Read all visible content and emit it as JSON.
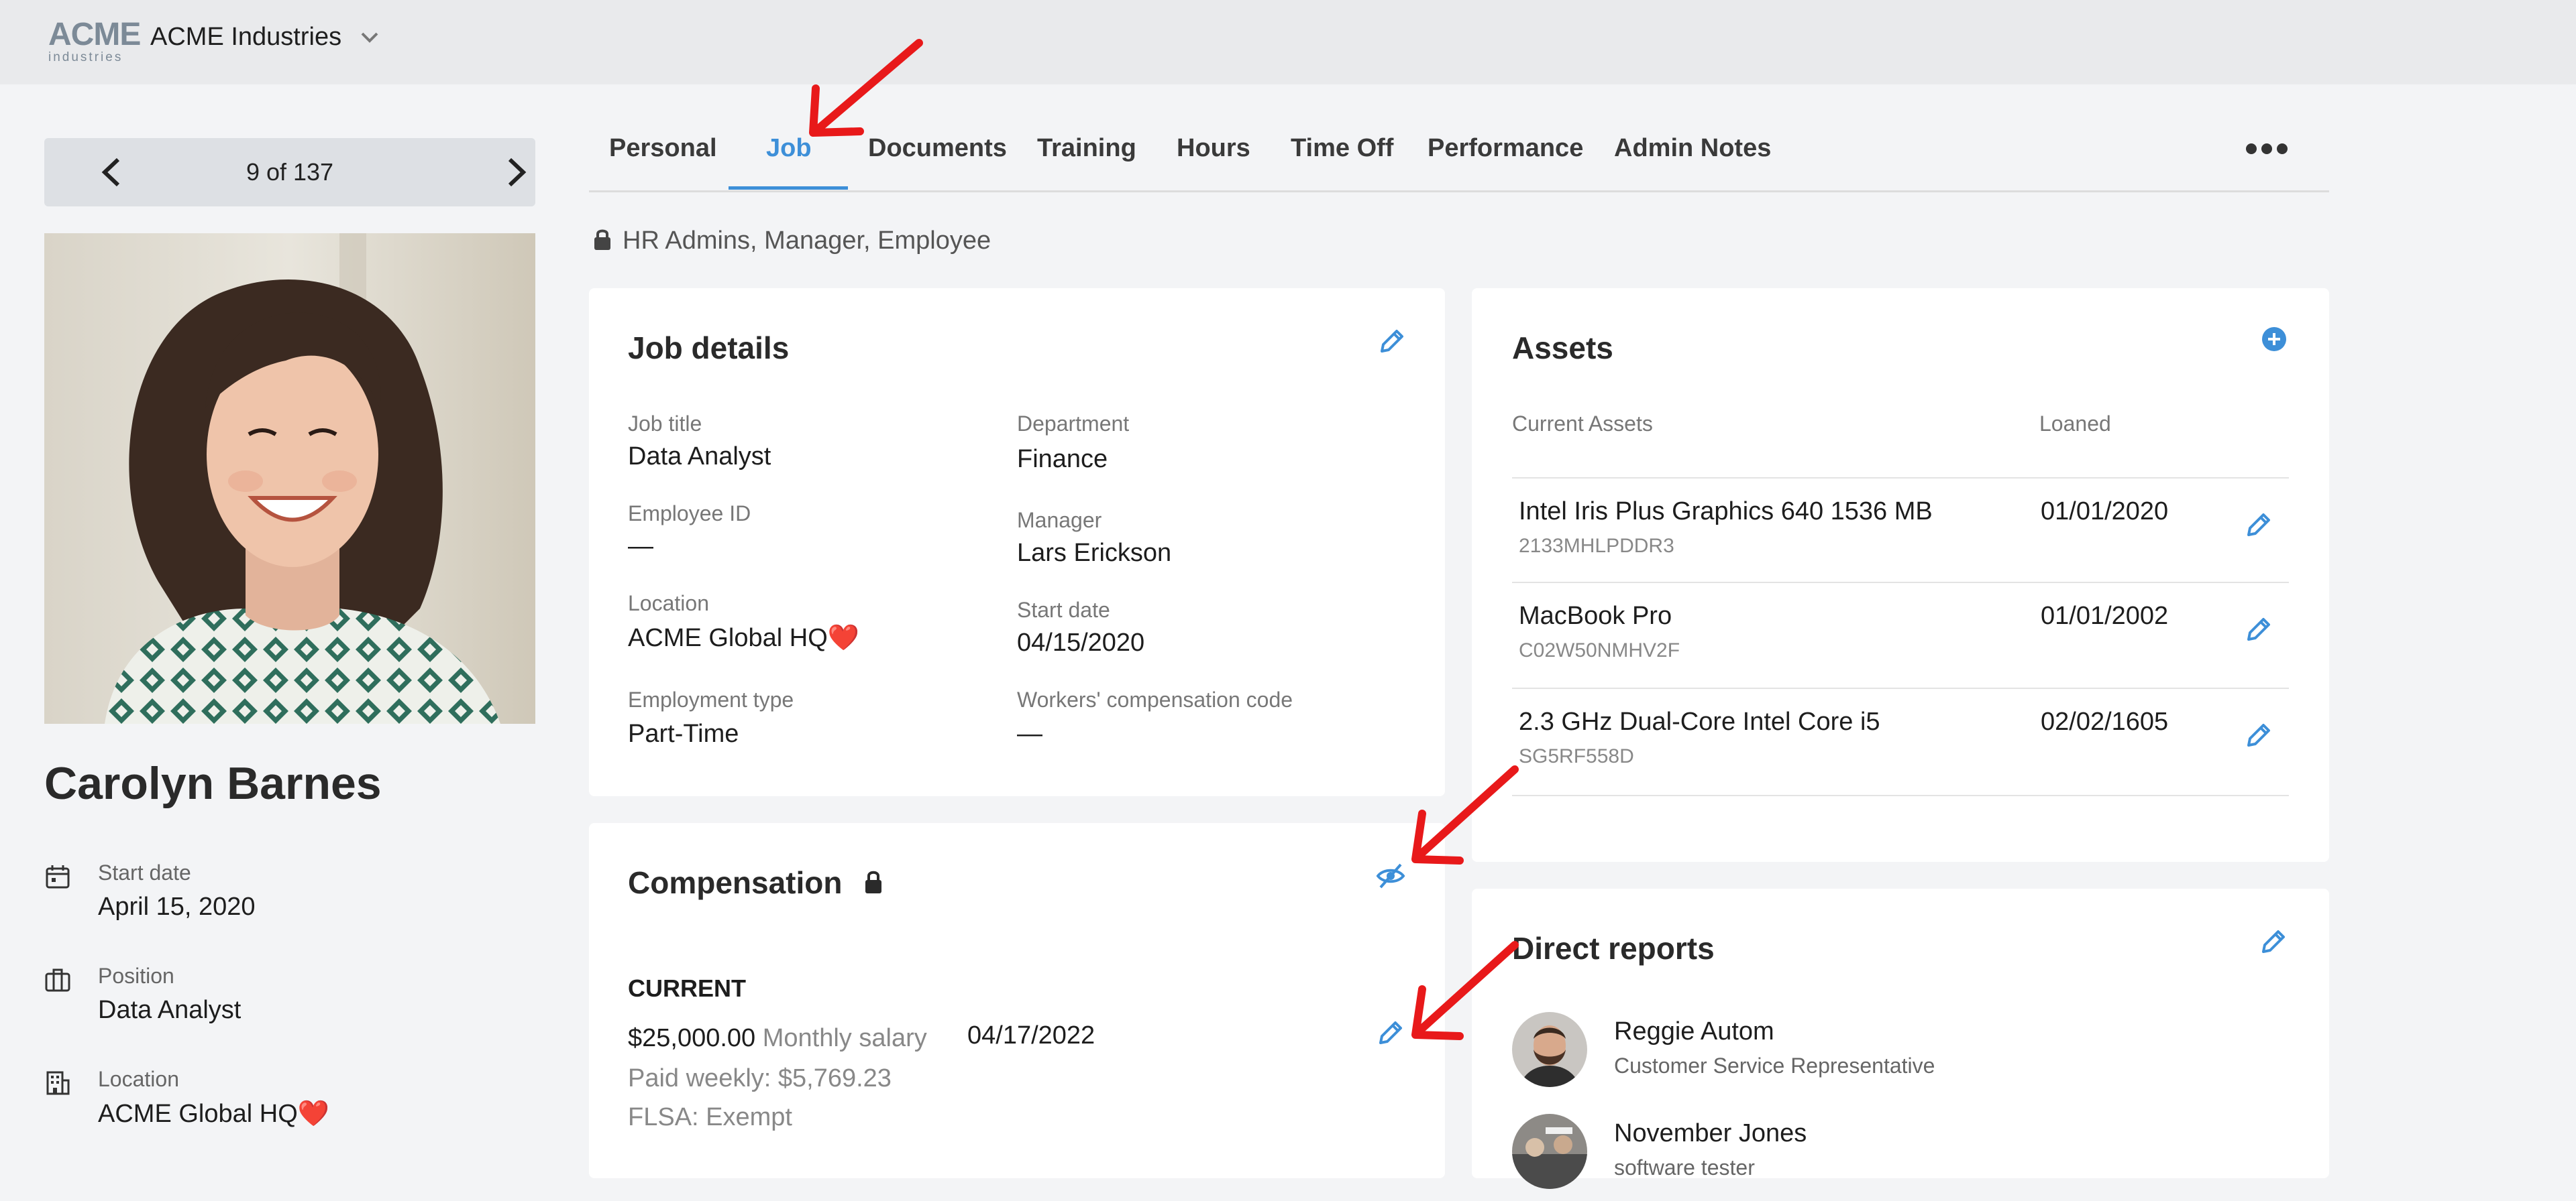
{
  "topbar": {
    "logo_big": "ACME",
    "logo_small": "industries",
    "company": "ACME Industries"
  },
  "pager": {
    "count": "9 of 137"
  },
  "employee": {
    "name": "Carolyn Barnes",
    "start_date_label": "Start date",
    "start_date": "April 15, 2020",
    "position_label": "Position",
    "position": "Data Analyst",
    "location_label": "Location",
    "location": "ACME Global HQ❤️"
  },
  "tabs": [
    "Personal",
    "Job",
    "Documents",
    "Training",
    "Hours",
    "Time Off",
    "Performance",
    "Admin Notes"
  ],
  "active_tab": "Job",
  "permission": "HR Admins, Manager, Employee",
  "job_details": {
    "title": "Job details",
    "job_title_label": "Job title",
    "job_title": "Data Analyst",
    "department_label": "Department",
    "department": "Finance",
    "employee_id_label": "Employee ID",
    "employee_id": "—",
    "manager_label": "Manager",
    "manager": "Lars Erickson",
    "location_label": "Location",
    "location": "ACME Global HQ❤️",
    "start_date_label": "Start date",
    "start_date": "04/15/2020",
    "employment_type_label": "Employment type",
    "employment_type": "Part-Time",
    "workers_comp_label": "Workers' compensation code",
    "workers_comp": "—"
  },
  "assets": {
    "title": "Assets",
    "col_current": "Current Assets",
    "col_loaned": "Loaned",
    "items": [
      {
        "name": "Intel Iris Plus Graphics 640 1536 MB",
        "serial": "2133MHLPDDR3",
        "loaned": "01/01/2020"
      },
      {
        "name": "MacBook Pro",
        "serial": "C02W50NMHV2F",
        "loaned": "01/01/2002"
      },
      {
        "name": "2.3 GHz Dual-Core Intel Core i5",
        "serial": "SG5RF558D",
        "loaned": "02/02/1605"
      }
    ]
  },
  "compensation": {
    "title": "Compensation",
    "current_label": "CURRENT",
    "amount": "$25,000.00",
    "period": "Monthly salary",
    "date": "04/17/2022",
    "paid": "Paid weekly: $5,769.23",
    "flsa": "FLSA: Exempt"
  },
  "direct_reports": {
    "title": "Direct reports",
    "items": [
      {
        "name": "Reggie Autom",
        "title": "Customer Service Representative"
      },
      {
        "name": "November Jones",
        "title": "software tester"
      }
    ]
  },
  "icons": {
    "accent": "#3d8fd8",
    "arrow_color": "#e8191a"
  }
}
